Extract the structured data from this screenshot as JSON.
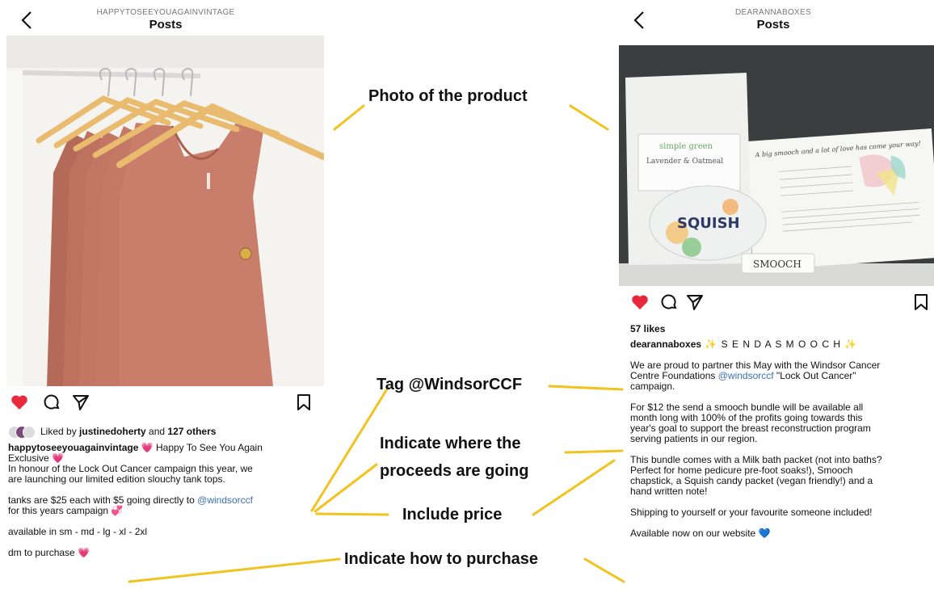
{
  "left": {
    "header_user": "HAPPYTOSEEYOUAGAINVINTAGE",
    "header_title": "Posts",
    "liked_prefix": "Liked by ",
    "liked_user": "justinedoherty",
    "liked_and": " and ",
    "liked_others": "127 others",
    "caption_user": "happytoseeyouagainvintage",
    "caption_line1": " 💗 Happy To See You Again",
    "caption_line2": "Exclusive 💗",
    "caption_line3": "In honour of the Lock Out Cancer campaign this year, we",
    "caption_line4": "are launching our limited edition slouchy tank tops.",
    "caption_line5a": "tanks are $25 each with $5 going directly to ",
    "caption_mention": "@windsorccf",
    "caption_line6": "for this years campaign 💞",
    "caption_line7": "available in sm - md - lg - xl - 2xl",
    "caption_line8": "dm to purchase 💗"
  },
  "right": {
    "header_user": "DEARANNABOXES",
    "header_title": "Posts",
    "likes": "57 likes",
    "caption_user": "dearannaboxes",
    "caption_title": " ✨ S E N D  A  S M O O C H ✨",
    "p1_line1": "We are proud to partner this May with the Windsor Cancer",
    "p1_line2a": "Centre Foundations ",
    "p1_mention": "@windsorccf",
    "p1_line2b": " \"Lock Out Cancer\"",
    "p1_line3": "campaign.",
    "p2_line1": "For $12 the send a smooch bundle will be available all",
    "p2_line2": "month long with 100% of the profits going towards this",
    "p2_line3": "year's goal to support the breast reconstruction program",
    "p2_line4": "serving patients in our region.",
    "p3_line1": "This bundle comes with a Milk bath packet (not into baths?",
    "p3_line2": "Perfect for home pedicure pre-foot soaks!), Smooch",
    "p3_line3": "chapstick, a Squish candy packet (vegan friendly!) and a",
    "p3_line4": "hand written note!",
    "p4_line1": "Shipping to yourself or your favourite someone included!",
    "p5_line1": "Available now on our website 💙",
    "product": {
      "bag_brand": "simple green",
      "bag_label": "Lavender & Oatmeal",
      "candy": "SQUISH",
      "chapstick": "SMOOCH",
      "note": "A big smooch and a lot of love has come your way!"
    }
  },
  "annotations": {
    "photo": "Photo of the product",
    "tag": "Tag @WindsorCCF",
    "proceeds_1": "Indicate where the",
    "proceeds_2": "proceeds are going",
    "price": "Include price",
    "purchase": "Indicate how to purchase"
  },
  "colors": {
    "heart": "#e8283c",
    "mention": "#3b6fb6",
    "annotation_line": "#f2c21f",
    "tank": "#c67a68",
    "hanger": "#e9bb6f"
  },
  "icons": [
    "back-chevron-icon",
    "heart-icon",
    "comment-icon",
    "share-icon",
    "bookmark-icon"
  ]
}
